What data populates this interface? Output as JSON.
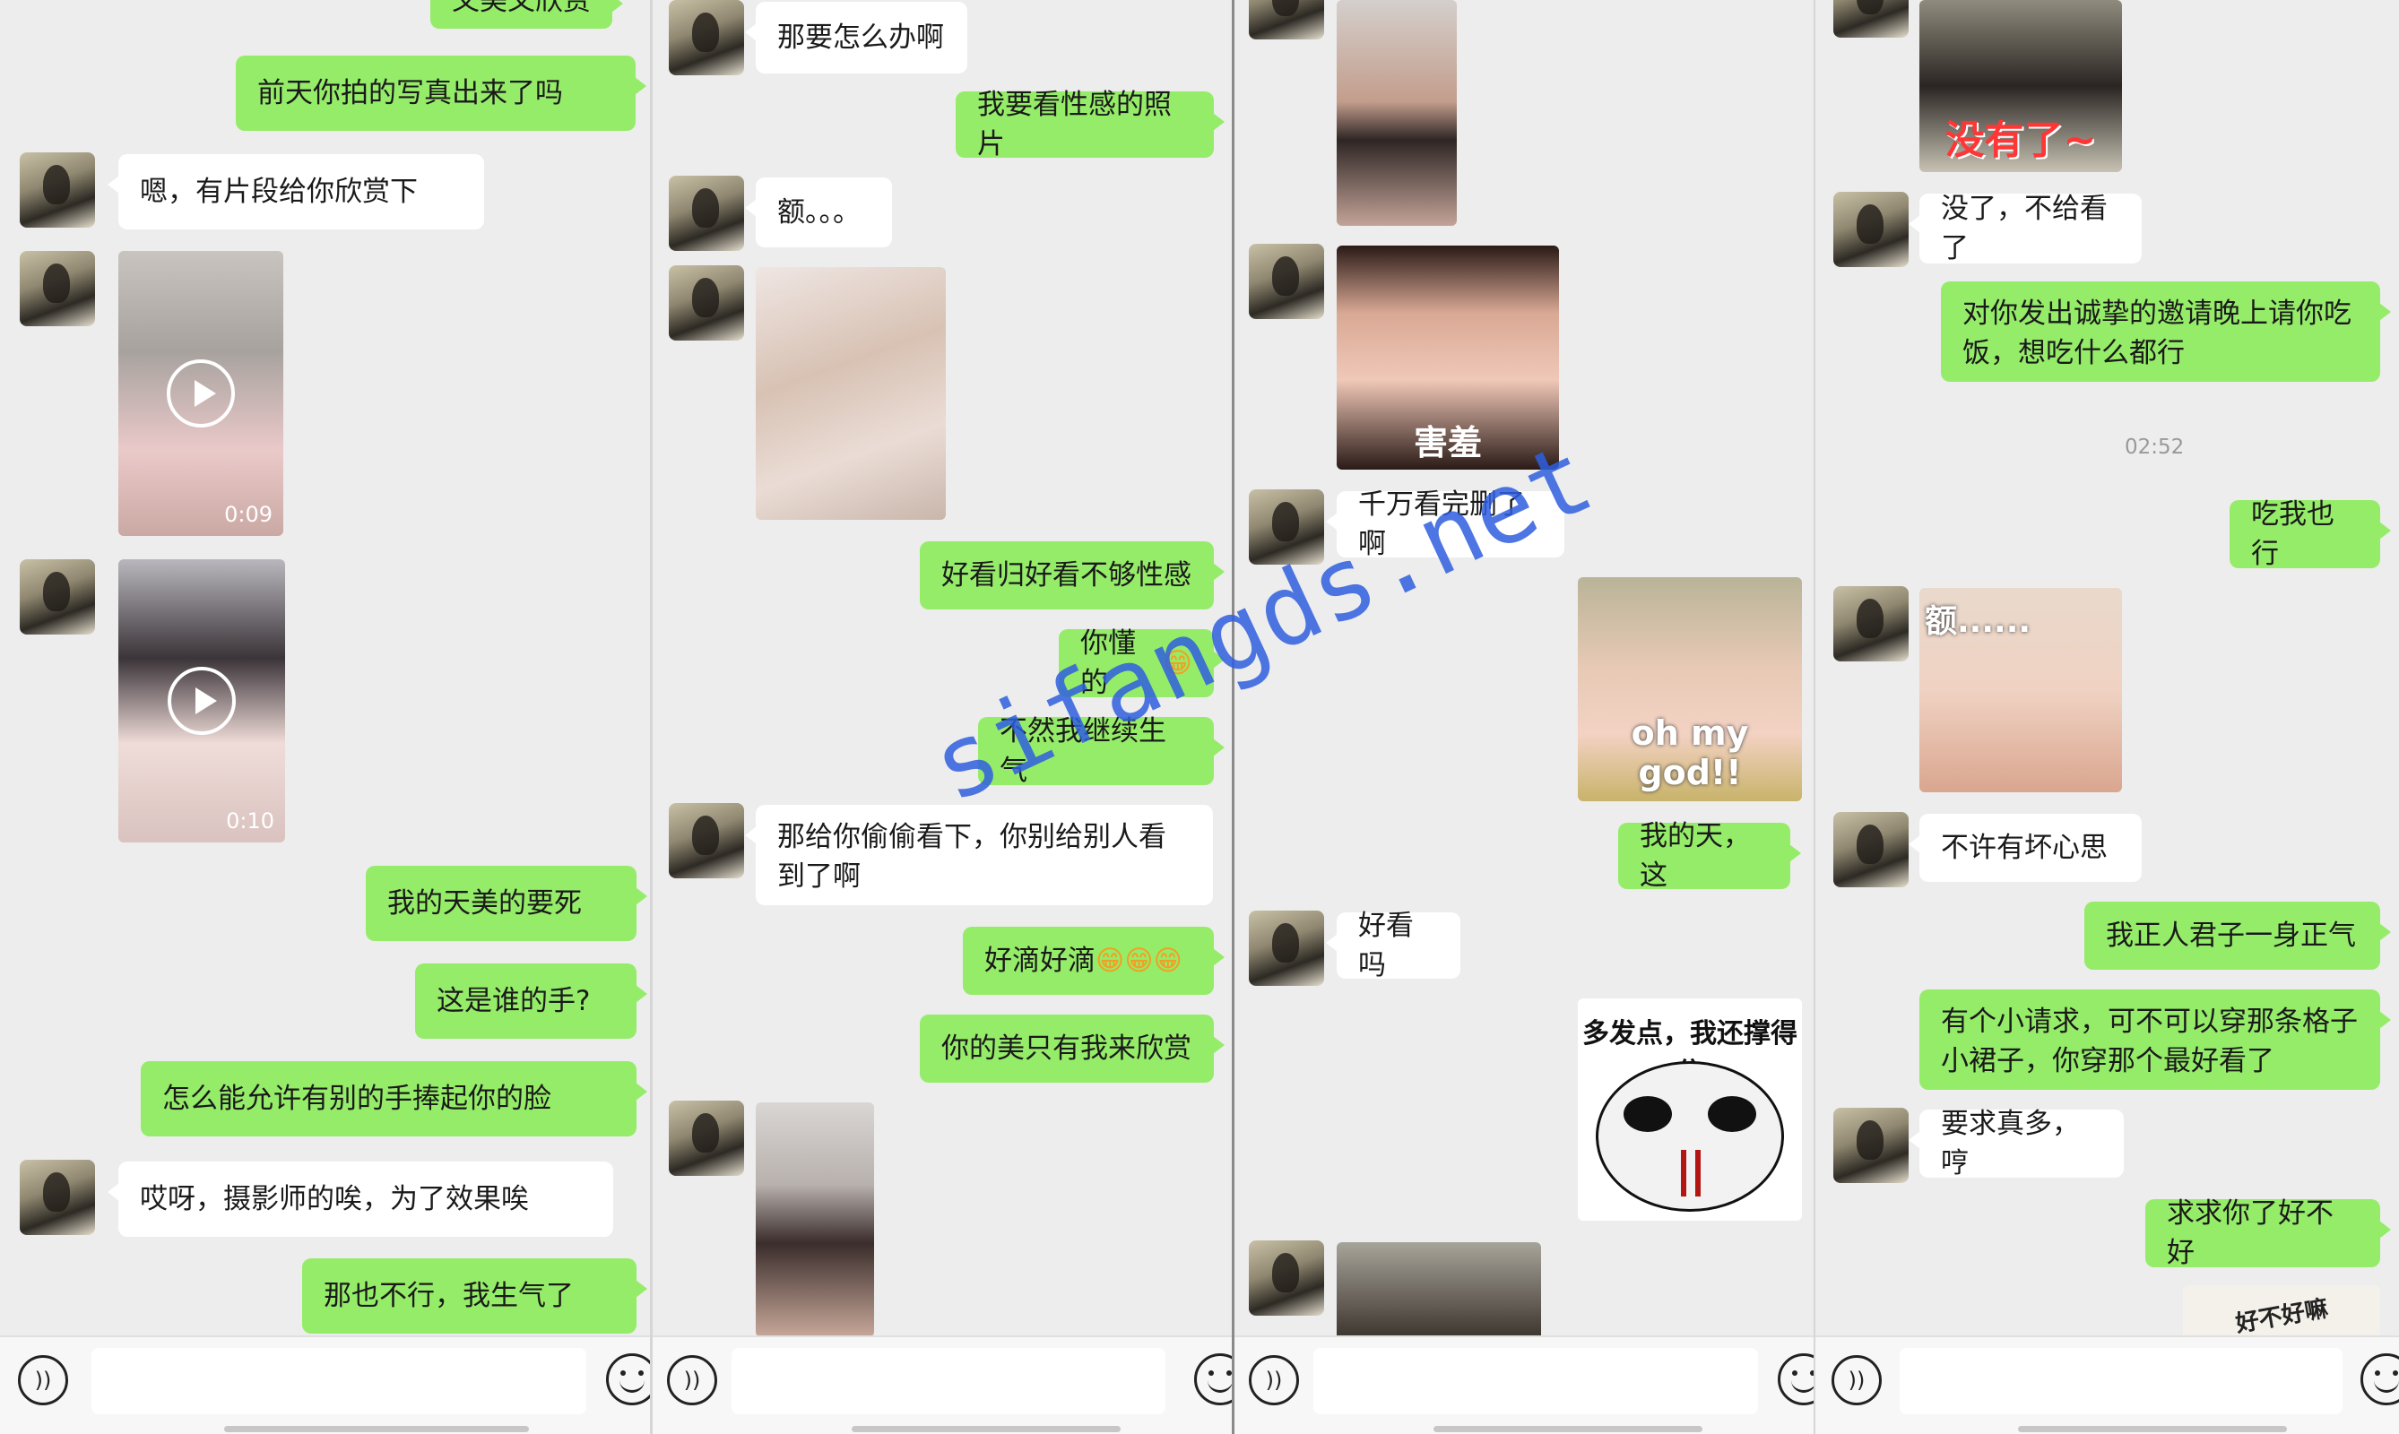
{
  "watermark": "sifangds.net",
  "panel1": {
    "partial_top": "又美又欣赏",
    "msg1": "前天你拍的写真出来了吗",
    "msg2": "嗯，有片段给你欣赏下",
    "video1_duration": "0:09",
    "video2_duration": "0:10",
    "msg3": "我的天美的要死",
    "msg4": "这是谁的手?",
    "msg5": "怎么能允许有别的手捧起你的脸",
    "msg6": "哎呀，摄影师的唉，为了效果唉",
    "msg7": "那也不行，我生气了"
  },
  "panel2": {
    "msg1": "那要怎么办啊",
    "msg2": "我要看性感的照片",
    "msg3": "额。。。",
    "msg4": "好看归好看不够性感",
    "msg5": "你懂的",
    "msg6": "不然我继续生气",
    "msg7": "那给你偷偷看下，你别给别人看到了啊",
    "msg8": "好滴好滴",
    "msg9": "你的美只有我来欣赏"
  },
  "panel3": {
    "sticker1_caption": "害羞",
    "msg1": "千万看完删了啊",
    "sticker2_caption": "oh my god!!",
    "msg2": "我的天，这",
    "msg3": "好看吗",
    "sticker3_caption": "多发点，我还撑得住"
  },
  "panel4": {
    "sticker1_caption": "没有了~",
    "msg1": "没了，不给看了",
    "msg2": "对你发出诚挚的邀请晚上请你吃饭，想吃什么都行",
    "timestamp": "02:52",
    "msg3": "吃我也行",
    "sticker2_caption": "额......",
    "msg4": "不许有坏心思",
    "msg5": "我正人君子一身正气",
    "msg6": "有个小请求，可不可以穿那条格子小裙子，你穿那个最好看了",
    "msg7": "要求真多，哼",
    "msg8": "求求你了好不好",
    "sticker3_caption": "好不好嘛"
  },
  "emoji_char": "😁",
  "voice_icon_char": "))",
  "colors": {
    "outgoing": "#95ec69",
    "incoming": "#ffffff",
    "background": "#ededed"
  }
}
